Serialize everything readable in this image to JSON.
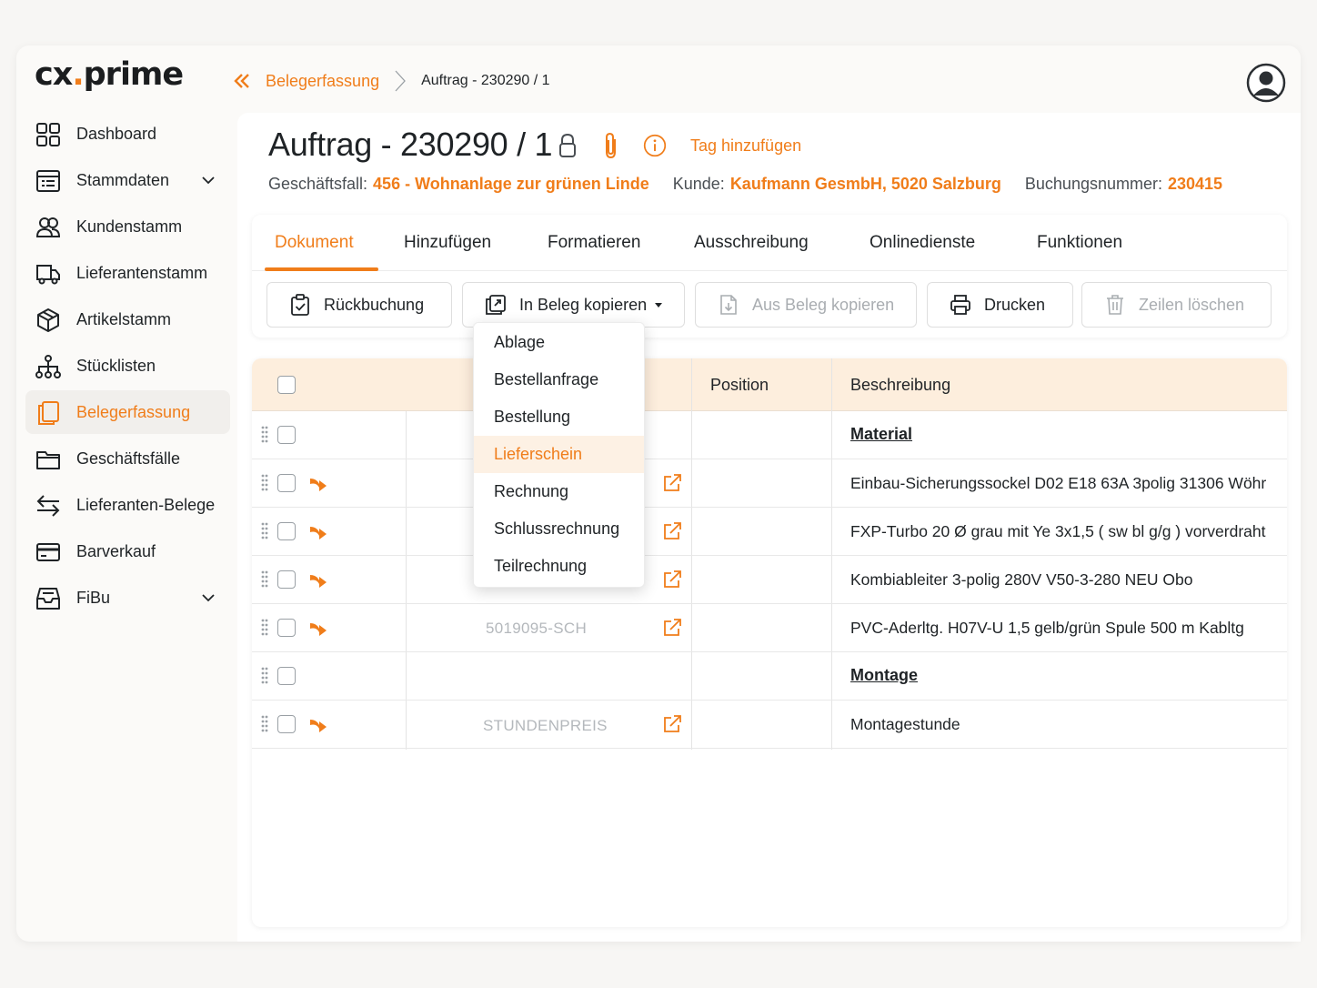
{
  "app": {
    "logo_main": "cx",
    "logo_dot": ".",
    "logo_tail": "prime"
  },
  "sidebar": {
    "items": [
      {
        "label": "Dashboard",
        "icon": "dashboard-grid-icon"
      },
      {
        "label": "Stammdaten",
        "icon": "list-icon",
        "expandable": true
      },
      {
        "label": "Kundenstamm",
        "icon": "users-icon"
      },
      {
        "label": "Lieferantenstamm",
        "icon": "truck-icon"
      },
      {
        "label": "Artikelstamm",
        "icon": "box-icon"
      },
      {
        "label": "Stücklisten",
        "icon": "hierarchy-icon"
      },
      {
        "label": "Belegerfassung",
        "icon": "documents-icon",
        "active": true
      },
      {
        "label": "Geschäftsfälle",
        "icon": "folder-icon"
      },
      {
        "label": "Lieferanten-Belege",
        "icon": "swap-arrows-icon"
      },
      {
        "label": "Barverkauf",
        "icon": "card-icon"
      },
      {
        "label": "FiBu",
        "icon": "inbox-icon",
        "expandable": true
      }
    ]
  },
  "breadcrumb": {
    "link": "Belegerfassung",
    "current": "Auftrag - 230290 / 1"
  },
  "header": {
    "title": "Auftrag - 230290 / 1",
    "tag_link": "Tag hinzufügen",
    "geschaeftsfall_label": "Geschäftsfall:",
    "geschaeftsfall_value": "456 - Wohnanlage zur grünen Linde",
    "kunde_label": "Kunde:",
    "kunde_value": "Kaufmann GesmbH, 5020 Salzburg",
    "buchung_label": "Buchungsnummer:",
    "buchung_value": "230415"
  },
  "tabs": [
    "Dokument",
    "Hinzufügen",
    "Formatieren",
    "Ausschreibung",
    "Onlinedienste",
    "Funktionen"
  ],
  "active_tab": "Dokument",
  "toolbar": {
    "rueckbuchung": "Rückbuchung",
    "in_beleg_kopieren": "In Beleg kopieren",
    "aus_beleg_kopieren": "Aus Beleg kopieren",
    "drucken": "Drucken",
    "zeilen_loeschen": "Zeilen löschen"
  },
  "dropdown": {
    "items": [
      "Ablage",
      "Bestellanfrage",
      "Bestellung",
      "Lieferschein",
      "Rechnung",
      "Schlussrechnung",
      "Teilrechnung"
    ],
    "highlighted": "Lieferschein"
  },
  "table": {
    "headers": {
      "position": "Position",
      "beschreibung": "Beschreibung"
    },
    "rows": [
      {
        "type": "section",
        "artno": "",
        "description": "Material"
      },
      {
        "type": "item",
        "artno": "",
        "description": "Einbau-Sicherungssockel D02 E18 63A 3polig 31306 Wöhr"
      },
      {
        "type": "item",
        "artno": "",
        "description": "FXP-Turbo 20 Ø grau mit Ye 3x1,5 ( sw bl g/g ) vorverdraht"
      },
      {
        "type": "item",
        "artno": "",
        "description": "Kombiableiter 3-polig 280V V50-3-280 NEU Obo"
      },
      {
        "type": "item",
        "artno": "5019095-SCH",
        "description": "PVC-Aderltg. H07V-U 1,5 gelb/grün Spule 500 m Kabltg"
      },
      {
        "type": "section",
        "artno": "",
        "description": "Montage"
      },
      {
        "type": "item",
        "artno": "STUNDENPREIS",
        "description": "Montagestunde"
      }
    ]
  },
  "colors": {
    "accent": "#f07d1a",
    "header_row": "#fdeedd",
    "text": "#1f2326"
  }
}
